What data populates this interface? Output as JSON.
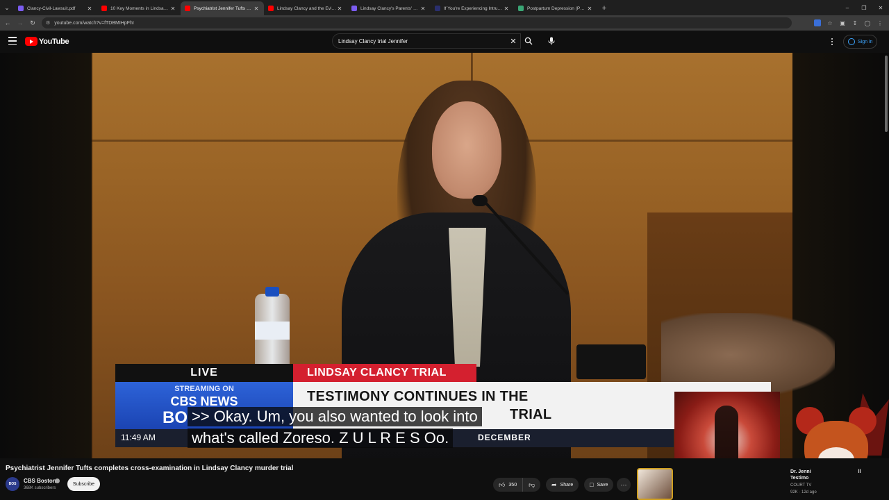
{
  "browser": {
    "tabs": [
      {
        "title": "Clancy-Civil-Lawsuit.pdf",
        "favicon_color": "#7b5cf0",
        "active": false
      },
      {
        "title": "10 Key Moments in Lindsay Cla",
        "favicon_color": "#ff0000",
        "active": false
      },
      {
        "title": "Psychiatrist Jennifer Tufts comp",
        "favicon_color": "#ff0000",
        "active": true
      },
      {
        "title": "Lindsay Clancy and the Eviden",
        "favicon_color": "#ff0000",
        "active": false
      },
      {
        "title": "Lindsay Clancy's Parents' $1 Mi",
        "favicon_color": "#7b5cf0",
        "active": false
      },
      {
        "title": "If You're Experiencing Intrusive",
        "favicon_color": "#2a2f6e",
        "active": false
      },
      {
        "title": "Postpartum Depression (PPD) ·",
        "favicon_color": "#3aa675",
        "active": false
      }
    ],
    "url": "youtube.com/watch?v=fTDBMIHpFhI"
  },
  "masthead": {
    "logo_text": "YouTube",
    "search_value": "Lindsay Clancy trial Jennifer",
    "signin_label": "Sign in"
  },
  "video_frame": {
    "live_label": "LIVE",
    "streaming_on": "STREAMING ON",
    "network": "CBS NEWS",
    "network_city_partial": "BO",
    "trial_tag": "LINDSAY CLANCY TRIAL",
    "headline_line1": "TESTIMONY CONTINUES IN THE",
    "headline_line2_visible": "TRIAL",
    "ticker_time": "11:49 AM",
    "ticker_text_visible": "DECEMBER",
    "captions": [
      ">> Okay. Um, you also wanted to look into",
      "what's called Zoreso. Z U L R E S Oo."
    ]
  },
  "video_info": {
    "title": "Psychiatrist Jennifer Tufts completes cross-examination in Lindsay Clancy murder trial",
    "channel_name": "CBS Boston",
    "channel_avatar_text": "BOS",
    "subscribers": "368K subscribers",
    "subscribe_label": "Subscribe",
    "like_count": "350",
    "share_label": "Share",
    "save_label": "Save"
  },
  "recommendation": {
    "title_line1": "Dr. Jenni",
    "title_line2": "Testimo",
    "title_suffix": "ll",
    "channel": "COURT TV",
    "meta": "92K · 12d ago"
  },
  "colors": {
    "brand_red": "#ff0000",
    "link_blue": "#3ea6ff",
    "cbs_blue": "#1b44b3",
    "trial_red": "#d4202f"
  },
  "icons": {
    "search": "search-icon",
    "mic": "mic-icon",
    "clear": "close-icon",
    "like": "thumbs-up-icon",
    "dislike": "thumbs-down-icon",
    "share": "share-icon",
    "save": "bookmark-icon",
    "more": "more-horizontal-icon"
  }
}
